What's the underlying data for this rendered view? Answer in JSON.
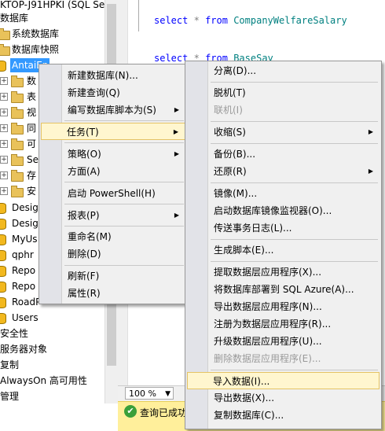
{
  "tree": {
    "header_title": "KTOP-J91HPKI (SQL Se",
    "rows": [
      {
        "label": "数据库"
      },
      {
        "label": "系统数据库"
      },
      {
        "label": "数据库快照"
      },
      {
        "label": "AntaiEn"
      },
      {
        "label": "数"
      },
      {
        "label": "表"
      },
      {
        "label": "视"
      },
      {
        "label": "同"
      },
      {
        "label": "可"
      },
      {
        "label": "Se"
      },
      {
        "label": "存"
      },
      {
        "label": "安"
      },
      {
        "label": "Desig"
      },
      {
        "label": "Desig"
      },
      {
        "label": "MyUs"
      },
      {
        "label": "qphr"
      },
      {
        "label": "Repo"
      },
      {
        "label": "Repo"
      },
      {
        "label": "RoadP"
      },
      {
        "label": "Users"
      },
      {
        "label": "安全性"
      },
      {
        "label": "服务器对象"
      },
      {
        "label": "复制"
      },
      {
        "label": "AlwaysOn 高可用性"
      },
      {
        "label": "管理"
      }
    ]
  },
  "editor": {
    "line1": {
      "kw": "select",
      "op": "*",
      "kw2": "from",
      "table": "CompanyWelfareSalary"
    },
    "line2": {
      "kw": "select",
      "op": "*",
      "kw2": "from",
      "table": "BaseSay"
    }
  },
  "zoom": {
    "value": "100 %"
  },
  "status": {
    "text": "查询已成功"
  },
  "context_menu": {
    "items": [
      {
        "label": "新建数据库(N)..."
      },
      {
        "label": "新建查询(Q)"
      },
      {
        "label": "编写数据库脚本为(S)"
      },
      {
        "label": "任务(T)"
      },
      {
        "label": "策略(O)"
      },
      {
        "label": "方面(A)"
      },
      {
        "label": "启动 PowerShell(H)"
      },
      {
        "label": "报表(P)"
      },
      {
        "label": "重命名(M)"
      },
      {
        "label": "删除(D)"
      },
      {
        "label": "刷新(F)"
      },
      {
        "label": "属性(R)"
      }
    ]
  },
  "tasks_menu": {
    "items": [
      {
        "label": "分离(D)..."
      },
      {
        "label": "脱机(T)"
      },
      {
        "label": "联机(I)"
      },
      {
        "label": "收缩(S)"
      },
      {
        "label": "备份(B)..."
      },
      {
        "label": "还原(R)"
      },
      {
        "label": "镜像(M)..."
      },
      {
        "label": "启动数据库镜像监视器(O)..."
      },
      {
        "label": "传送事务日志(L)..."
      },
      {
        "label": "生成脚本(E)..."
      },
      {
        "label": "提取数据层应用程序(X)..."
      },
      {
        "label": "将数据库部署到 SQL Azure(A)..."
      },
      {
        "label": "导出数据层应用程序(N)..."
      },
      {
        "label": "注册为数据层应用程序(R)..."
      },
      {
        "label": "升级数据层应用程序(U)..."
      },
      {
        "label": "删除数据层应用程序(E)..."
      },
      {
        "label": "导入数据(I)..."
      },
      {
        "label": "导出数据(X)..."
      },
      {
        "label": "复制数据库(C)..."
      }
    ]
  }
}
